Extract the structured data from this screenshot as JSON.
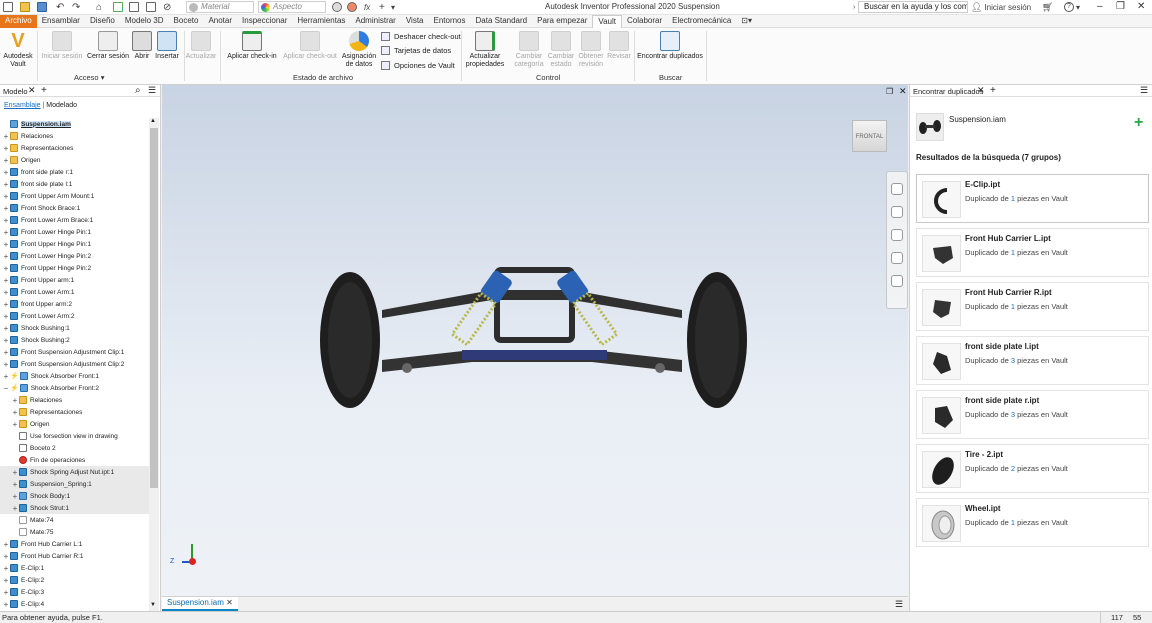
{
  "app": {
    "title": "Autodesk Inventor Professional 2020   Suspension",
    "help_search": "Buscar en la ayuda y los comand",
    "signin": "Iniciar sesión",
    "help_icon": "?"
  },
  "qat": {
    "material": "Material",
    "aspect": "Aspecto",
    "fx": "fx"
  },
  "tabs": [
    "Archivo",
    "Ensamblar",
    "Diseño",
    "Modelo 3D",
    "Boceto",
    "Anotar",
    "Inspeccionar",
    "Herramientas",
    "Administrar",
    "Vista",
    "Entornos",
    "Data Standard",
    "Para empezar",
    "Vault",
    "Colaborar",
    "Electromecánica"
  ],
  "ribbon": {
    "autodesk_vault": "Autodesk Vault",
    "iniciar_sesion": "Iniciar sesión",
    "cerrar_sesion": "Cerrar sesión",
    "abrir": "Abrir",
    "insertar": "Insertar",
    "actualizar": "Actualizar",
    "aplicar_checkin": "Aplicar check-in",
    "aplicar_checkout": "Aplicar check-out",
    "asignacion": "Asignación de datos",
    "deshacer_checkout": "Deshacer check-out",
    "tarjetas": "Tarjetas de datos",
    "opciones": "Opciones de Vault",
    "actualizar_prop": "Actualizar propiedades",
    "cambiar_cat": "Cambiar categoría",
    "cambiar_estado": "Cambiar estado",
    "obtener_rev": "Obtener revisión",
    "revisar": "Revisar",
    "encontrar": "Encontrar duplicados",
    "grp_acceso": "Acceso",
    "grp_estado": "Estado de archivo",
    "grp_control": "Control",
    "grp_buscar": "Buscar"
  },
  "browser": {
    "title": "Modelo",
    "tab_ensamblaje": "Ensamblaje",
    "tab_modelado": "Modelado",
    "rows": [
      {
        "label": "Suspension.iam",
        "icon": "asm",
        "exp": "",
        "indent": 0,
        "top": true
      },
      {
        "label": "Relaciones",
        "icon": "folder",
        "exp": "+",
        "indent": 0
      },
      {
        "label": "Representaciones",
        "icon": "folder",
        "exp": "+",
        "indent": 0
      },
      {
        "label": "Origen",
        "icon": "folder",
        "exp": "+",
        "indent": 0
      },
      {
        "label": "front side plate r:1",
        "icon": "part",
        "exp": "+",
        "indent": 0
      },
      {
        "label": "front side plate l:1",
        "icon": "part",
        "exp": "+",
        "indent": 0
      },
      {
        "label": "Front Upper Arm Mount:1",
        "icon": "part",
        "exp": "+",
        "indent": 0
      },
      {
        "label": "Front Shock Brace:1",
        "icon": "part",
        "exp": "+",
        "indent": 0
      },
      {
        "label": "Front Lower Arm Brace:1",
        "icon": "part",
        "exp": "+",
        "indent": 0
      },
      {
        "label": "Front Lower Hinge Pin:1",
        "icon": "part",
        "exp": "+",
        "indent": 0
      },
      {
        "label": "Front Upper Hinge Pin:1",
        "icon": "part",
        "exp": "+",
        "indent": 0
      },
      {
        "label": "Front Lower Hinge Pin:2",
        "icon": "part",
        "exp": "+",
        "indent": 0
      },
      {
        "label": "Front Upper Hinge Pin:2",
        "icon": "part",
        "exp": "+",
        "indent": 0
      },
      {
        "label": "Front Upper arm:1",
        "icon": "part",
        "exp": "+",
        "indent": 0
      },
      {
        "label": "Front Lower Arm:1",
        "icon": "part",
        "exp": "+",
        "indent": 0
      },
      {
        "label": "front Upper arm:2",
        "icon": "part",
        "exp": "+",
        "indent": 0
      },
      {
        "label": "Front Lower Arm:2",
        "icon": "part",
        "exp": "+",
        "indent": 0
      },
      {
        "label": "Shock Bushing:1",
        "icon": "part",
        "exp": "+",
        "indent": 0
      },
      {
        "label": "Shock Bushing:2",
        "icon": "part",
        "exp": "+",
        "indent": 0
      },
      {
        "label": "Front Suspension Adjustment Clip:1",
        "icon": "part",
        "exp": "+",
        "indent": 0
      },
      {
        "label": "Front Suspension Adjustment Clip:2",
        "icon": "part",
        "exp": "+",
        "indent": 0
      },
      {
        "label": "Shock Absorber Front:1",
        "icon": "asm",
        "exp": "+",
        "indent": 0,
        "bolt": true
      },
      {
        "label": "Shock Absorber Front:2",
        "icon": "asm",
        "exp": "−",
        "indent": 0,
        "bolt": true
      },
      {
        "label": "Relaciones",
        "icon": "folder",
        "exp": "+",
        "indent": 1
      },
      {
        "label": "Representaciones",
        "icon": "folder",
        "exp": "+",
        "indent": 1
      },
      {
        "label": "Origen",
        "icon": "folder",
        "exp": "+",
        "indent": 1
      },
      {
        "label": "Use forsection view in drawing",
        "icon": "paper",
        "exp": "",
        "indent": 1
      },
      {
        "label": "Boceto 2",
        "icon": "paper",
        "exp": "",
        "indent": 1
      },
      {
        "label": "Fin de operaciones",
        "icon": "red",
        "exp": "",
        "indent": 1
      },
      {
        "label": "Shock Spring Adjust Nut.ipt:1",
        "icon": "part",
        "exp": "+",
        "indent": 1,
        "hl": true
      },
      {
        "label": "Suspension_Spring:1",
        "icon": "part",
        "exp": "+",
        "indent": 1,
        "hl": true
      },
      {
        "label": "Shock Body:1",
        "icon": "asm",
        "exp": "+",
        "indent": 1,
        "hl": true
      },
      {
        "label": "Shock Strut:1",
        "icon": "part",
        "exp": "+",
        "indent": 1,
        "hl": true
      },
      {
        "label": "Mate:74",
        "icon": "mate",
        "exp": "",
        "indent": 1
      },
      {
        "label": "Mate:75",
        "icon": "mate",
        "exp": "",
        "indent": 1
      },
      {
        "label": "Front Hub Carrier L:1",
        "icon": "part",
        "exp": "+",
        "indent": 0
      },
      {
        "label": "Front Hub Carrier R:1",
        "icon": "part",
        "exp": "+",
        "indent": 0
      },
      {
        "label": "E-Clip:1",
        "icon": "part",
        "exp": "+",
        "indent": 0
      },
      {
        "label": "E-Clip:2",
        "icon": "part",
        "exp": "+",
        "indent": 0
      },
      {
        "label": "E-Clip:3",
        "icon": "part",
        "exp": "+",
        "indent": 0
      },
      {
        "label": "E-Clip:4",
        "icon": "part",
        "exp": "+",
        "indent": 0
      }
    ]
  },
  "viewport": {
    "viewcube_label": "FRONTAL",
    "doc_tab": "Suspension.iam",
    "axis_z": "Z"
  },
  "panel": {
    "title": "Encontrar duplicados",
    "assembly": "Suspension.iam",
    "results_title": "Resultados de la búsqueda (7 grupos)",
    "dup_prefix": "Duplicado de",
    "dup_suffix": "piezas en Vault",
    "results": [
      {
        "name": "E-Clip.ipt",
        "count": "1"
      },
      {
        "name": "Front Hub Carrier L.ipt",
        "count": "1"
      },
      {
        "name": "Front Hub Carrier R.ipt",
        "count": "1"
      },
      {
        "name": "front side plate l.ipt",
        "count": "3"
      },
      {
        "name": "front side plate r.ipt",
        "count": "3"
      },
      {
        "name": "Tire - 2.ipt",
        "count": "2"
      },
      {
        "name": "Wheel.ipt",
        "count": "1"
      }
    ]
  },
  "status": {
    "text": "Para obtener ayuda, pulse F1.",
    "n1": "117",
    "n2": "55"
  },
  "colors": {
    "file_tab": "#e7761b",
    "accent_blue": "#0a84c9",
    "add_green": "#28a745"
  }
}
